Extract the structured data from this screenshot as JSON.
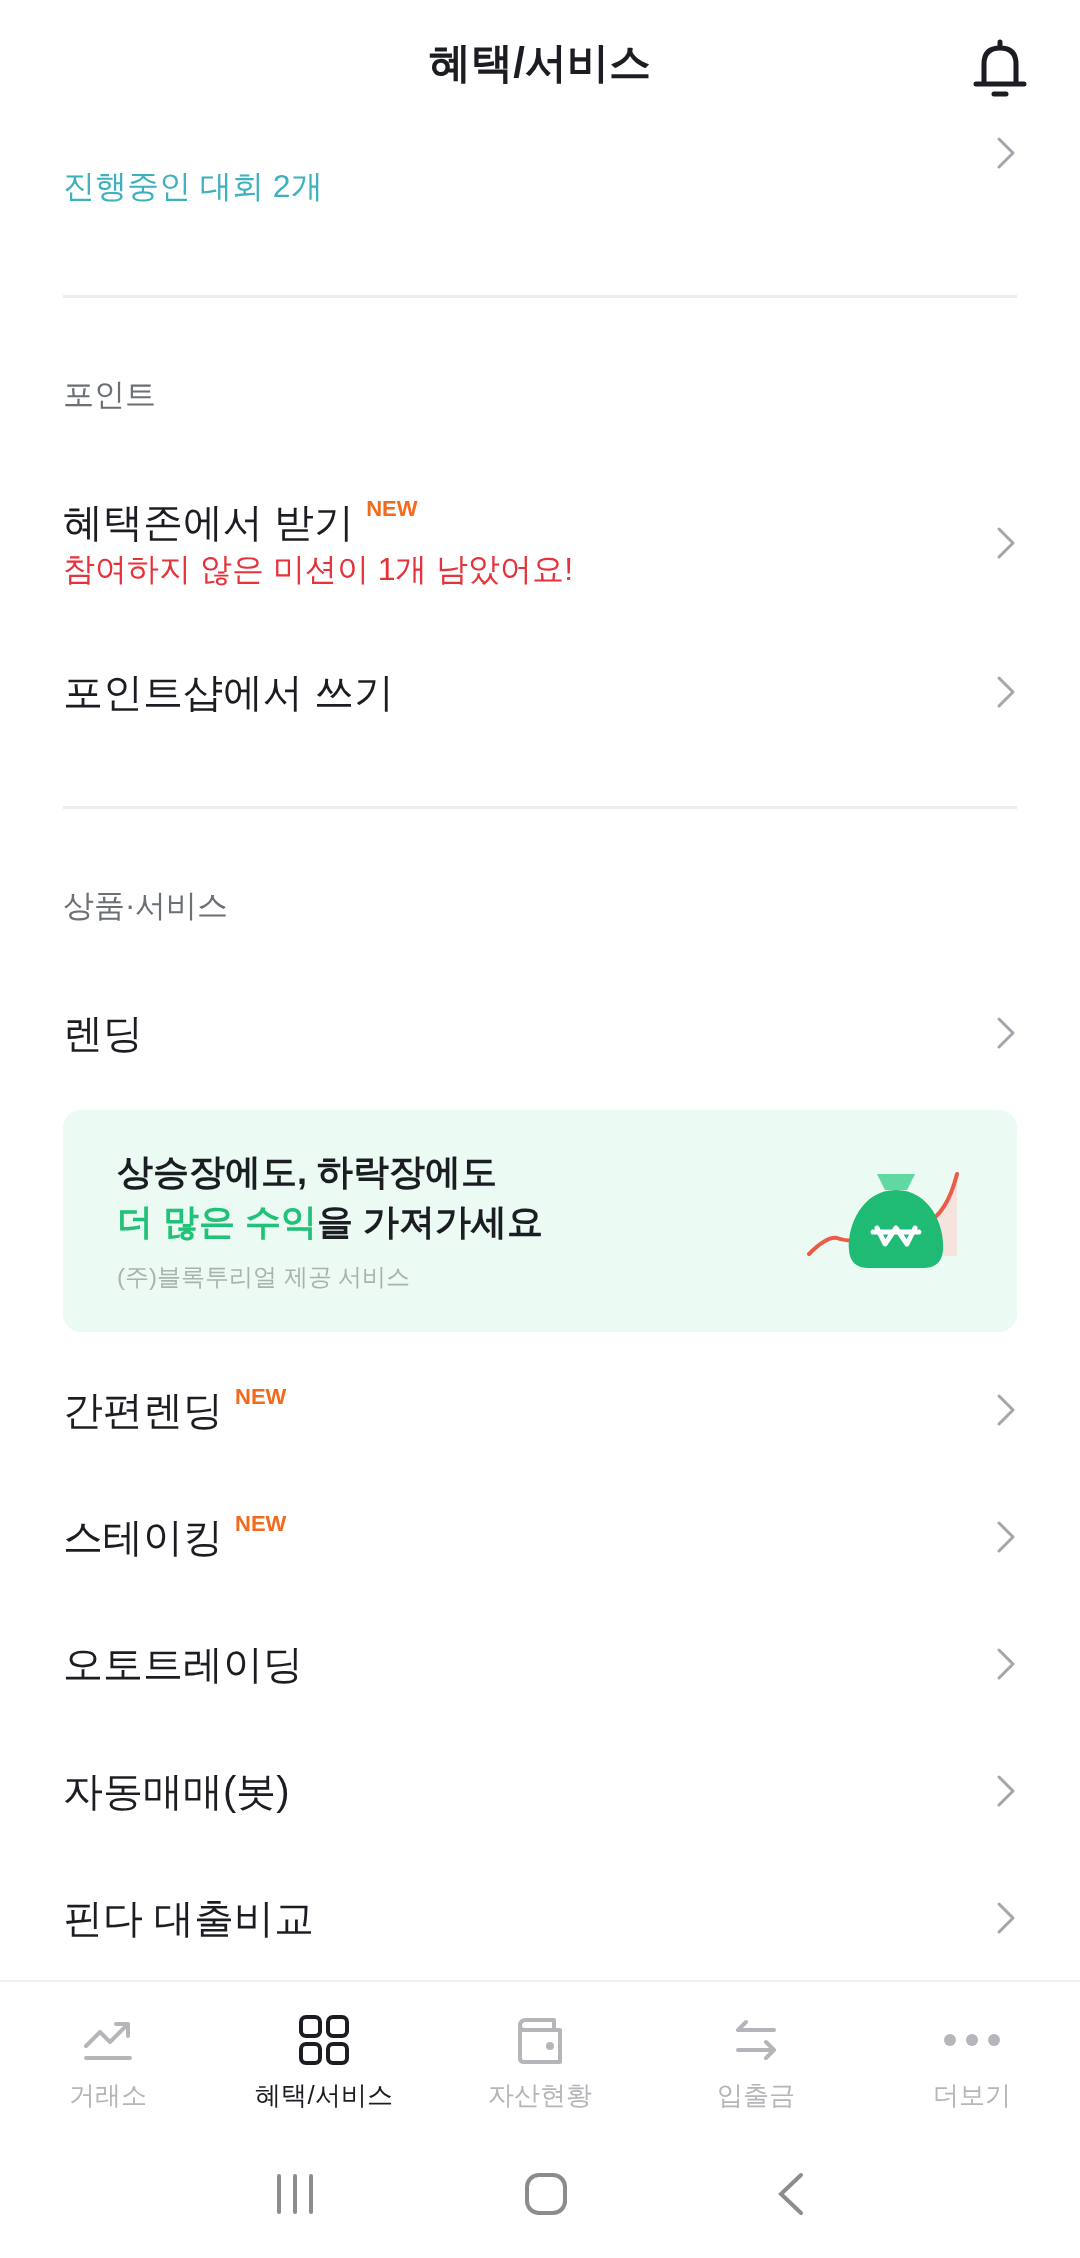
{
  "header": {
    "title": "혜택/서비스"
  },
  "top_partial": {
    "subtitle": {
      "text": "진행중인 대회 2개",
      "kind": "info"
    }
  },
  "sections": [
    {
      "label": "포인트",
      "items": [
        {
          "title": "혜택존에서 받기",
          "badge": "NEW",
          "subtitle": {
            "text": "참여하지 않은 미션이 1개 남았어요!",
            "kind": "alert"
          }
        },
        {
          "title": "포인트샵에서 쓰기"
        }
      ]
    },
    {
      "label": "상품·서비스",
      "items": [
        {
          "title": "렌딩",
          "kind": "row"
        },
        {
          "kind": "banner",
          "line1": "상승장에도, 하락장에도",
          "highlight": "더 많은 수익",
          "rest": "을 가져가세요",
          "note": "(주)블록투리얼 제공 서비스"
        },
        {
          "title": "간편렌딩",
          "badge": "NEW",
          "kind": "row"
        },
        {
          "title": "스테이킹",
          "badge": "NEW",
          "kind": "row"
        },
        {
          "title": "오토트레이딩",
          "kind": "row"
        },
        {
          "title": "자동매매(봇)",
          "kind": "row"
        },
        {
          "title": "핀다 대출비교",
          "kind": "row"
        }
      ]
    }
  ],
  "bottom_nav": [
    {
      "label": "거래소",
      "selected": false
    },
    {
      "label": "혜택/서비스",
      "selected": true
    },
    {
      "label": "자산현황",
      "selected": false
    },
    {
      "label": "입출금",
      "selected": false
    },
    {
      "label": "더보기",
      "selected": false
    }
  ]
}
